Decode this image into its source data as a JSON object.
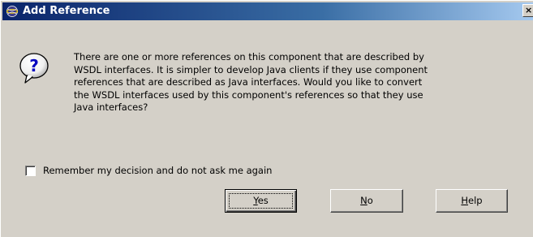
{
  "window": {
    "title": "Add Reference",
    "close_glyph": "×"
  },
  "dialog": {
    "icon": "question-icon",
    "message": "There are one or more references on this component that are described by\nWSDL interfaces. It is simpler to develop Java clients if they use component\nreferences that are described as Java interfaces. Would you like to convert\nthe WSDL interfaces used by this component's references so that they use\nJava interfaces?",
    "remember_label": "Remember my decision and do not ask me again",
    "remember_checked": false
  },
  "buttons": {
    "yes": {
      "mnemonic": "Y",
      "rest": "es"
    },
    "no": {
      "mnemonic": "N",
      "rest": "o"
    },
    "help": {
      "mnemonic": "H",
      "rest": "elp"
    }
  },
  "colors": {
    "title_start": "#0a246a",
    "title_end": "#a6caf0",
    "face": "#d4d0c8"
  }
}
